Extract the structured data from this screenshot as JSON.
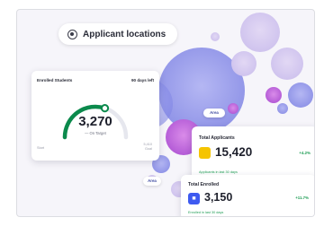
{
  "header": {
    "title": "Applicant locations",
    "icon": "location-icon"
  },
  "enrolled_card": {
    "title": "Enrolled Students",
    "period": "90 days left",
    "value": "3,270",
    "status": "— On Target",
    "min_label": "Start",
    "max_label": "5,410",
    "max_sub": "Goal",
    "progress_fraction": 0.6,
    "accent_color": "#0b8a4c"
  },
  "applicants_card": {
    "label": "Total Applicants",
    "value": "15,420",
    "change": "+4.2%",
    "footnote": "Applicants in last 30 days",
    "icon": "folder-icon",
    "icon_color": "#f5c400"
  },
  "enrolled_total_card": {
    "label": "Total Enrolled",
    "value": "3,150",
    "change": "+11.7%",
    "footnote": "Enrolled in last 30 days",
    "icon": "student-icon",
    "icon_color": "#3e5af0"
  },
  "map_labels": {
    "north": "Area",
    "south": "Area"
  },
  "colors": {
    "bubble_blue": "#8b90e8",
    "bubble_purple": "#c46ae0",
    "background": "#f6f5fa"
  }
}
